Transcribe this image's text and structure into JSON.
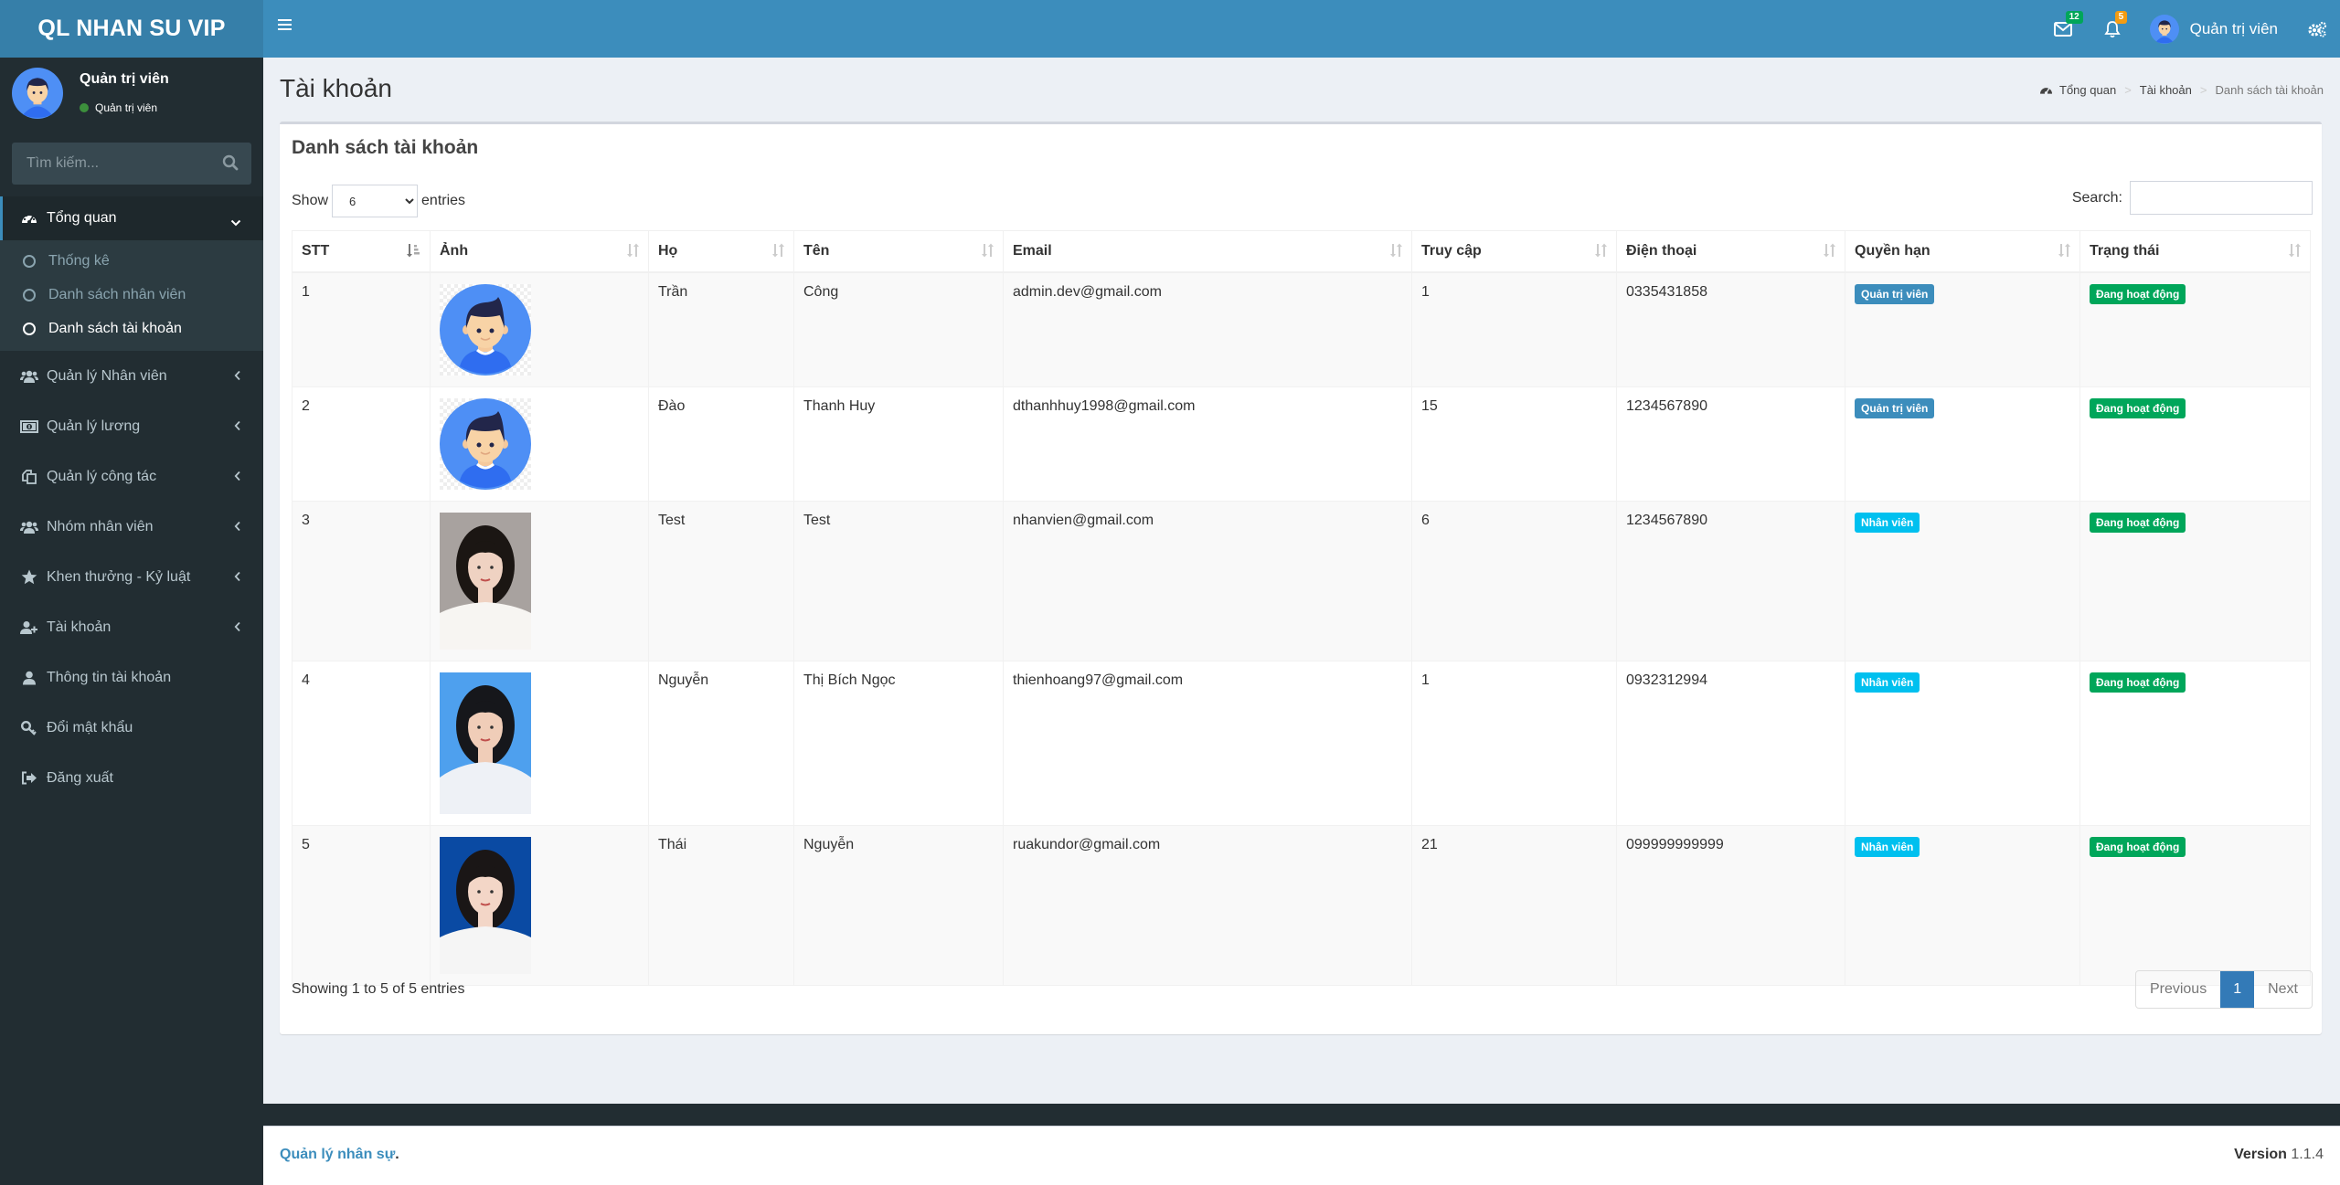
{
  "app": {
    "logo": "QL NHAN SU VIP",
    "accent_color": "#3c8dbc"
  },
  "navbar": {
    "toggle_icon": "hamburger-icon",
    "messages": {
      "icon": "envelope-icon",
      "count": "12",
      "badge_color": "#00a65a"
    },
    "notifications": {
      "icon": "bell-icon",
      "count": "5",
      "badge_color": "#f39c12"
    },
    "user_name": "Quản trị viên",
    "settings_icon": "gears-icon"
  },
  "sidebar": {
    "user": {
      "name": "Quản trị viên",
      "status": "Quản trị viên"
    },
    "search_placeholder": "Tìm kiếm...",
    "menu": [
      {
        "label": "Tổng quan",
        "icon": "dashboard-icon",
        "active": true,
        "children": [
          {
            "label": "Thống kê"
          },
          {
            "label": "Danh sách nhân viên"
          },
          {
            "label": "Danh sách tài khoản",
            "current": true
          }
        ]
      },
      {
        "label": "Quản lý Nhân viên",
        "icon": "users-icon"
      },
      {
        "label": "Quản lý lương",
        "icon": "money-icon"
      },
      {
        "label": "Quản lý công tác",
        "icon": "copy-icon"
      },
      {
        "label": "Nhóm nhân viên",
        "icon": "users-icon"
      },
      {
        "label": "Khen thưởng - Kỷ luật",
        "icon": "star-icon"
      },
      {
        "label": "Tài khoản",
        "icon": "user-plus-icon"
      },
      {
        "label": "Thông tin tài khoản",
        "icon": "user-icon"
      },
      {
        "label": "Đổi mật khẩu",
        "icon": "key-icon"
      },
      {
        "label": "Đăng xuất",
        "icon": "sign-out-icon"
      }
    ]
  },
  "page": {
    "title": "Tài khoản",
    "breadcrumb": [
      "Tổng quan",
      "Tài khoản",
      "Danh sách tài khoản"
    ]
  },
  "box": {
    "title": "Danh sách tài khoản",
    "show_label": "Show",
    "entries_label": "entries",
    "page_length": "6",
    "search_label": "Search:",
    "search_value": ""
  },
  "table": {
    "columns": [
      "STT",
      "Ảnh",
      "Họ",
      "Tên",
      "Email",
      "Truy cập",
      "Điện thoại",
      "Quyền hạn",
      "Trạng thái"
    ],
    "rows": [
      {
        "stt": "1",
        "photo": "avatar-cartoon",
        "ho": "Trần",
        "ten": "Công",
        "email": "admin.dev@gmail.com",
        "truy_cap": "1",
        "phone": "0335431858",
        "role": "Quản trị viên",
        "role_color": "#3c8dbc",
        "status": "Đang hoạt động",
        "status_color": "#00a65a"
      },
      {
        "stt": "2",
        "photo": "avatar-cartoon",
        "ho": "Đào",
        "ten": "Thanh Huy",
        "email": "dthanhhuy1998@gmail.com",
        "truy_cap": "15",
        "phone": "1234567890",
        "role": "Quản trị viên",
        "role_color": "#3c8dbc",
        "status": "Đang hoạt động",
        "status_color": "#00a65a"
      },
      {
        "stt": "3",
        "photo": "portrait-gray",
        "ho": "Test",
        "ten": "Test",
        "email": "nhanvien@gmail.com",
        "truy_cap": "6",
        "phone": "1234567890",
        "role": "Nhân viên",
        "role_color": "#00c0ef",
        "status": "Đang hoạt động",
        "status_color": "#00a65a"
      },
      {
        "stt": "4",
        "photo": "portrait-lightblue",
        "ho": "Nguyễn",
        "ten": "Thị Bích Ngọc",
        "email": "thienhoang97@gmail.com",
        "truy_cap": "1",
        "phone": "0932312994",
        "role": "Nhân viên",
        "role_color": "#00c0ef",
        "status": "Đang hoạt động",
        "status_color": "#00a65a"
      },
      {
        "stt": "5",
        "photo": "portrait-darkblue",
        "ho": "Thái",
        "ten": "Nguyễn",
        "email": "ruakundor@gmail.com",
        "truy_cap": "21",
        "phone": "099999999999",
        "role": "Nhân viên",
        "role_color": "#00c0ef",
        "status": "Đang hoạt động",
        "status_color": "#00a65a"
      }
    ]
  },
  "info": "Showing 1 to 5 of 5 entries",
  "pagination": {
    "previous": "Previous",
    "current": "1",
    "next": "Next"
  },
  "footer": {
    "brand": "Quản lý nhân sự",
    "brand_dot": ".",
    "version_label": "Version",
    "version": "1.1.4"
  }
}
